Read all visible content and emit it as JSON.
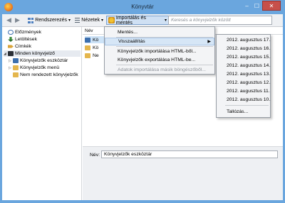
{
  "window": {
    "title": "Könyvtár",
    "controls": {
      "minimize": "–",
      "maximize": "☐",
      "close": "✕"
    }
  },
  "toolbar": {
    "back": "◀",
    "forward": "▶",
    "organize": "Rendszerezés",
    "views": "Nézetek",
    "import_export": "Importálás és mentés",
    "caret": "▾",
    "search_placeholder": "Keresés a könyvjelzők között"
  },
  "sidebar": {
    "items": [
      {
        "label": "Előzmények",
        "icon": "history-icon"
      },
      {
        "label": "Letöltések",
        "icon": "download-icon"
      },
      {
        "label": "Címkék",
        "icon": "tag-icon"
      },
      {
        "label": "Minden könyvjelző",
        "icon": "all-bookmarks-icon"
      },
      {
        "label": "Könyvjelzők eszköztár",
        "icon": "bookmarks-toolbar-icon"
      },
      {
        "label": "Könyvjelzők menü",
        "icon": "bookmarks-menu-icon"
      },
      {
        "label": "Nem rendezett könyvjelzők",
        "icon": "unsorted-bookmarks-icon"
      }
    ]
  },
  "list": {
    "column_header": "Név",
    "rows": [
      {
        "label": "Kö"
      },
      {
        "label": "Kö"
      },
      {
        "label": "Ne"
      }
    ]
  },
  "details": {
    "name_label": "Név:",
    "name_value": "Könyvjelzők eszköztár"
  },
  "import_menu": {
    "items": [
      {
        "label": "Mentés...",
        "disabled": false
      },
      {
        "label": "Visszaállítás",
        "disabled": false,
        "submenu": true
      },
      {
        "label": "Könyvjelzők importálása HTML-ből...",
        "disabled": false
      },
      {
        "label": "Könyvjelzők exportálása HTML-be...",
        "disabled": false
      },
      {
        "label": "Adatok importálása másik böngészőből...",
        "disabled": true
      }
    ],
    "submenu_arrow": "▶"
  },
  "restore_submenu": {
    "dates": [
      "2012. augusztus 17.",
      "2012. augusztus 16.",
      "2012. augusztus 15.",
      "2012. augusztus 14.",
      "2012. augusztus 13.",
      "2012. augusztus 12.",
      "2012. augusztus 11.",
      "2012. augusztus 10."
    ],
    "choose_file": "Tallózás..."
  }
}
